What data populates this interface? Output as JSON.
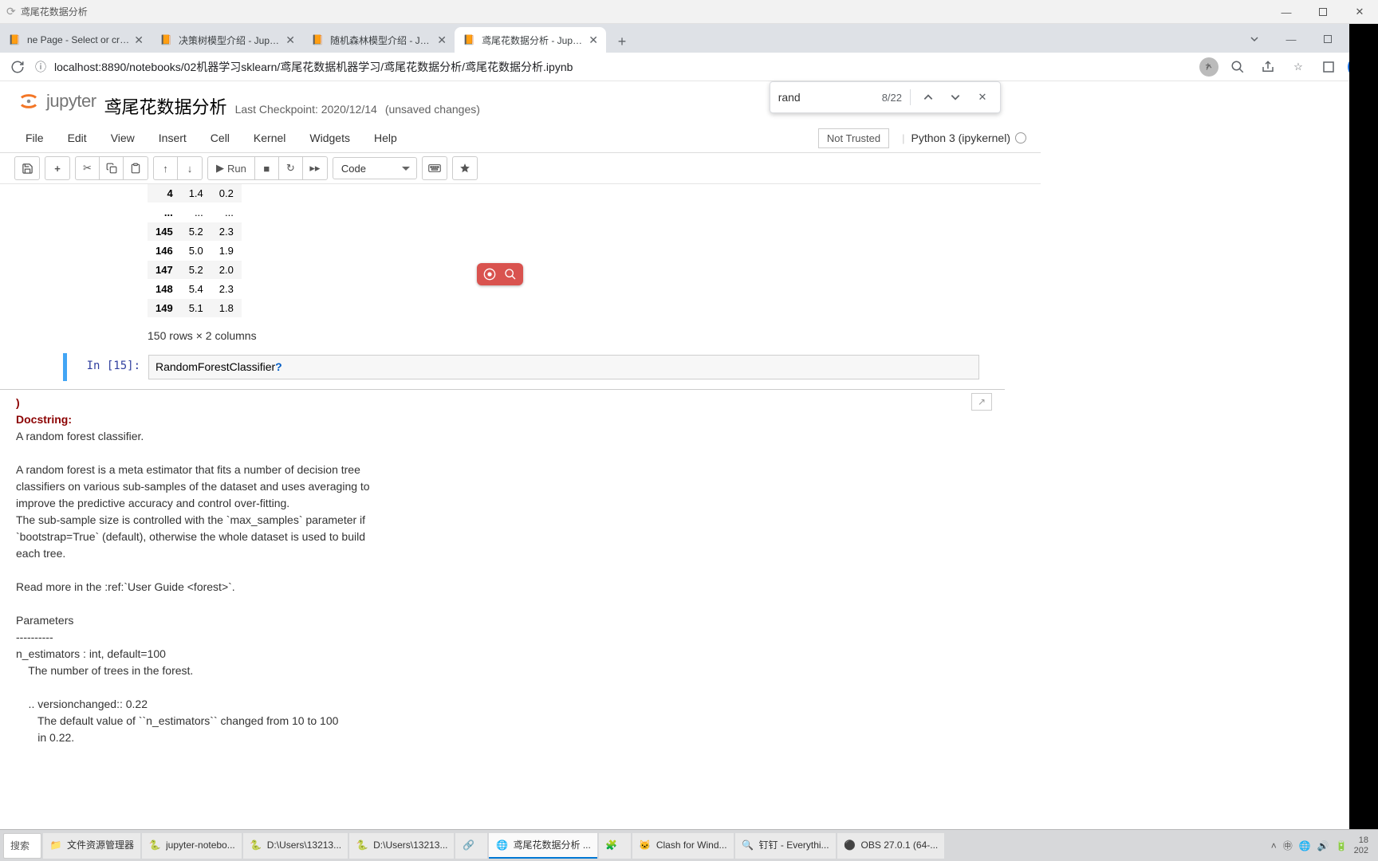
{
  "window": {
    "title": "鸢尾花数据分析",
    "min": "—",
    "max": "☐",
    "close": "✕"
  },
  "tabs": [
    {
      "label": "ne Page - Select or create",
      "icon": "jupyter"
    },
    {
      "label": "决策树模型介绍 - Jupyter Note",
      "icon": "jupyter"
    },
    {
      "label": "随机森林模型介绍 - Jupyter No",
      "icon": "jupyter"
    },
    {
      "label": "鸢尾花数据分析 - Jupyter Note",
      "icon": "jupyter",
      "active": true
    }
  ],
  "url": {
    "scheme_icon": "ⓘ",
    "text": "localhost:8890/notebooks/02机器学习sklearn/鸢尾花数据机器学习/鸢尾花数据分析/鸢尾花数据分析.ipynb"
  },
  "find": {
    "value": "rand",
    "count": "8/22"
  },
  "jupyter": {
    "logo_text": "jupyter",
    "title": "鸢尾花数据分析",
    "checkpoint": "Last Checkpoint: 2020/12/14",
    "unsaved": "(unsaved changes)"
  },
  "menus": {
    "file": "File",
    "edit": "Edit",
    "view": "View",
    "insert": "Insert",
    "cell": "Cell",
    "kernel": "Kernel",
    "widgets": "Widgets",
    "help": "Help"
  },
  "trust": {
    "label": "Not Trusted"
  },
  "kernel": {
    "name": "Python 3 (ipykernel)"
  },
  "toolbar": {
    "run": "Run",
    "celltype": "Code"
  },
  "table": {
    "rows": [
      {
        "idx": "4",
        "c1": "1.4",
        "c2": "0.2"
      },
      {
        "idx": "...",
        "c1": "...",
        "c2": "..."
      },
      {
        "idx": "145",
        "c1": "5.2",
        "c2": "2.3"
      },
      {
        "idx": "146",
        "c1": "5.0",
        "c2": "1.9"
      },
      {
        "idx": "147",
        "c1": "5.2",
        "c2": "2.0"
      },
      {
        "idx": "148",
        "c1": "5.4",
        "c2": "2.3"
      },
      {
        "idx": "149",
        "c1": "5.1",
        "c2": "1.8"
      }
    ],
    "summary": "150 rows × 2 columns"
  },
  "cell": {
    "prompt": "In [15]:",
    "code_pre": "RandomForestClassifier",
    "code_q": "?"
  },
  "docstring": {
    "paren": ")",
    "header": "Docstring:",
    "l1": "A random forest classifier.",
    "l2": "",
    "l3": "A random forest is a meta estimator that fits a number of decision tree",
    "l4": "classifiers on various sub-samples of the dataset and uses averaging to",
    "l5": "improve the predictive accuracy and control over-fitting.",
    "l6": "The sub-sample size is controlled with the `max_samples` parameter if",
    "l7": "`bootstrap=True` (default), otherwise the whole dataset is used to build",
    "l8": "each tree.",
    "l9": "",
    "l10": "Read more in the :ref:`User Guide <forest>`.",
    "l11": "",
    "l12": "Parameters",
    "l13": "----------",
    "l14": "n_estimators : int, default=100",
    "l15": "    The number of trees in the forest.",
    "l16": "",
    "l17": "    .. versionchanged:: 0.22",
    "l18": "       The default value of ``n_estimators`` changed from 10 to 100",
    "l19": "       in 0.22."
  },
  "taskbar": {
    "search_placeholder": "搜索",
    "items": [
      {
        "icon": "📁",
        "label": "文件资源管理器"
      },
      {
        "icon": "🐍",
        "label": "jupyter-notebo..."
      },
      {
        "icon": "🐍",
        "label": "D:\\Users\\13213..."
      },
      {
        "icon": "🐍",
        "label": "D:\\Users\\13213..."
      },
      {
        "icon": "🔗",
        "label": ""
      },
      {
        "icon": "🌐",
        "label": "鸢尾花数据分析 ..."
      },
      {
        "icon": "🧩",
        "label": ""
      },
      {
        "icon": "🐱",
        "label": "Clash for Wind..."
      },
      {
        "icon": "🔍",
        "label": "钉钉 - Everythi..."
      },
      {
        "icon": "⚫",
        "label": "OBS 27.0.1 (64-..."
      }
    ],
    "time": "18\n202"
  }
}
